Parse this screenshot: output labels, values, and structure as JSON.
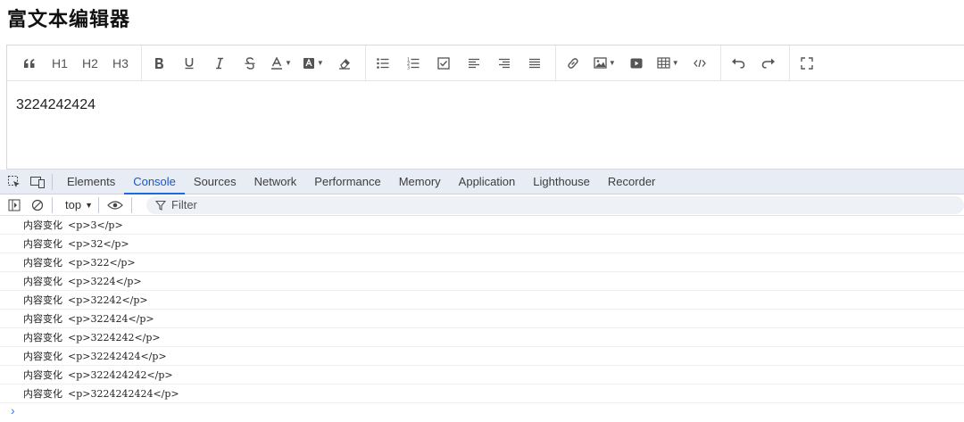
{
  "page": {
    "title": "富文本编辑器"
  },
  "editor": {
    "content": "3224242424",
    "toolbar": {
      "groups": [
        [
          {
            "name": "blockquote-button",
            "icon": "quote-icon",
            "label": ""
          },
          {
            "name": "h1-button",
            "icon": "",
            "label": "H1"
          },
          {
            "name": "h2-button",
            "icon": "",
            "label": "H2"
          },
          {
            "name": "h3-button",
            "icon": "",
            "label": "H3"
          }
        ],
        [
          {
            "name": "bold-button",
            "icon": "bold-icon",
            "label": ""
          },
          {
            "name": "underline-button",
            "icon": "underline-icon",
            "label": ""
          },
          {
            "name": "italic-button",
            "icon": "italic-icon",
            "label": ""
          },
          {
            "name": "strikethrough-button",
            "icon": "strikethrough-icon",
            "label": ""
          },
          {
            "name": "font-color-button",
            "icon": "font-color-icon",
            "label": "",
            "dropdown": true
          },
          {
            "name": "background-color-button",
            "icon": "background-color-icon",
            "label": "",
            "dropdown": true
          },
          {
            "name": "clear-format-button",
            "icon": "eraser-icon",
            "label": ""
          }
        ],
        [
          {
            "name": "bulleted-list-button",
            "icon": "bulleted-list-icon",
            "label": ""
          },
          {
            "name": "numbered-list-button",
            "icon": "numbered-list-icon",
            "label": ""
          },
          {
            "name": "todo-list-button",
            "icon": "checkbox-icon",
            "label": ""
          },
          {
            "name": "align-left-button",
            "icon": "align-left-icon",
            "label": ""
          },
          {
            "name": "align-right-button",
            "icon": "align-right-icon",
            "label": ""
          },
          {
            "name": "justify-button",
            "icon": "justify-icon",
            "label": ""
          }
        ],
        [
          {
            "name": "link-button",
            "icon": "link-icon",
            "label": ""
          },
          {
            "name": "image-button",
            "icon": "image-icon",
            "label": "",
            "dropdown": true
          },
          {
            "name": "video-button",
            "icon": "video-icon",
            "label": ""
          },
          {
            "name": "table-button",
            "icon": "table-icon",
            "label": "",
            "dropdown": true
          },
          {
            "name": "code-button",
            "icon": "code-icon",
            "label": ""
          }
        ],
        [
          {
            "name": "undo-button",
            "icon": "undo-icon",
            "label": ""
          },
          {
            "name": "redo-button",
            "icon": "redo-icon",
            "label": ""
          }
        ],
        [
          {
            "name": "fullscreen-button",
            "icon": "fullscreen-icon",
            "label": ""
          }
        ]
      ]
    }
  },
  "devtools": {
    "tabs": [
      "Elements",
      "Console",
      "Sources",
      "Network",
      "Performance",
      "Memory",
      "Application",
      "Lighthouse",
      "Recorder"
    ],
    "active_tab": "Console",
    "context": "top",
    "filter_placeholder": "Filter",
    "log_label": "内容变化",
    "logs": [
      "<p>3</p>",
      "<p>32</p>",
      "<p>322</p>",
      "<p>3224</p>",
      "<p>32242</p>",
      "<p>322424</p>",
      "<p>3224242</p>",
      "<p>32242424</p>",
      "<p>322424242</p>",
      "<p>3224242424</p>"
    ],
    "prompt_symbol": "›",
    "colors": {
      "tab_bar": "#e8edf5",
      "active_tab": "#1a56c5",
      "prompt": "#3b7be0"
    }
  }
}
